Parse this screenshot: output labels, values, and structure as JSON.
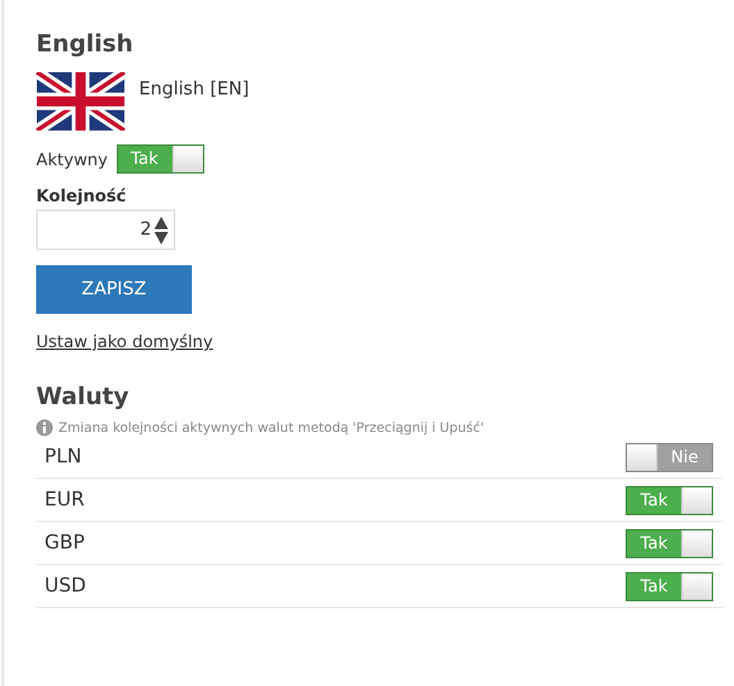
{
  "language": {
    "title": "English",
    "name": "English [EN]",
    "active_label": "Aktywny",
    "active": {
      "on": true,
      "label": "Tak"
    },
    "order_label": "Kolejność",
    "order_value": "2",
    "save_button": "ZAPISZ",
    "default_link": "Ustaw jako domyślny"
  },
  "currencies": {
    "title": "Waluty",
    "hint": "Zmiana kolejności aktywnych walut metodą 'Przeciągnij i Upuść'",
    "items": [
      {
        "code": "PLN",
        "on": false,
        "label": "Nie"
      },
      {
        "code": "EUR",
        "on": true,
        "label": "Tak"
      },
      {
        "code": "GBP",
        "on": true,
        "label": "Tak"
      },
      {
        "code": "USD",
        "on": true,
        "label": "Tak"
      }
    ]
  }
}
